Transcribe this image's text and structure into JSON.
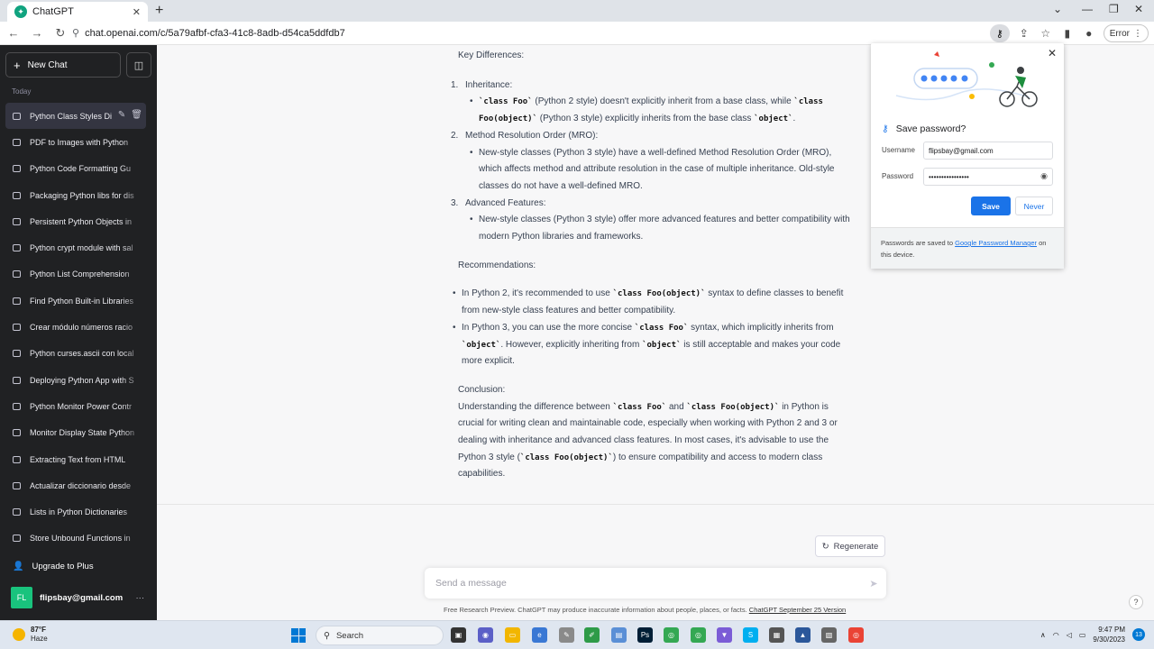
{
  "browser": {
    "tab_title": "ChatGPT",
    "url": "chat.openai.com/c/5a79afbf-cfa3-41c8-8adb-d54ca5ddfdb7",
    "error_label": "Error"
  },
  "sidebar": {
    "new_chat": "New Chat",
    "section_today": "Today",
    "conversations": [
      "Python Class Styles Di",
      "PDF to Images with Python",
      "Python Code Formatting Gu",
      "Packaging Python libs for dis",
      "Persistent Python Objects in",
      "Python crypt module with sal",
      "Python List Comprehension",
      "Find Python Built-in Libraries",
      "Crear módulo números racio",
      "Python curses.ascii con local",
      "Deploying Python App with S",
      "Python Monitor Power Contr",
      "Monitor Display State Python",
      "Extracting Text from HTML",
      "Actualizar diccionario desde",
      "Lists in Python Dictionaries",
      "Store Unbound Functions in"
    ],
    "upgrade": "Upgrade to Plus",
    "avatar_initials": "FL",
    "account_email": "flipsbay@gmail.com"
  },
  "message": {
    "key_diff": "Key Differences:",
    "n1": "1.",
    "inheritance": "Inheritance:",
    "inh_code1": "`class Foo`",
    "inh_t1": " (Python 2 style) doesn't explicitly inherit from a base class, while ",
    "inh_code2": "`class Foo(object)`",
    "inh_t2": " (Python 3 style) explicitly inherits from the base class ",
    "inh_code3": "`object`",
    "inh_t3": ".",
    "n2": "2.",
    "mro": "Method Resolution Order (MRO):",
    "mro_text": "New-style classes (Python 3 style) have a well-defined Method Resolution Order (MRO), which affects method and attribute resolution in the case of multiple inheritance. Old-style classes do not have a well-defined MRO.",
    "n3": "3.",
    "advanced": "Advanced Features:",
    "adv_text": "New-style classes (Python 3 style) offer more advanced features and better compatibility with modern Python libraries and frameworks.",
    "recs": "Recommendations:",
    "rec1_a": "In Python 2, it's recommended to use ",
    "rec1_code": "`class Foo(object)`",
    "rec1_b": " syntax to define classes to benefit from new-style class features and better compatibility.",
    "rec2_a": "In Python 3, you can use the more concise ",
    "rec2_code1": "`class Foo`",
    "rec2_b": " syntax, which implicitly inherits from ",
    "rec2_code2": "`object`",
    "rec2_c": ". However, explicitly inheriting from ",
    "rec2_code3": "`object`",
    "rec2_d": " is still acceptable and makes your code more explicit.",
    "conclusion": "Conclusion:",
    "conc_a": "Understanding the difference between ",
    "conc_code1": "`class Foo`",
    "conc_b": " and ",
    "conc_code2": "`class Foo(object)`",
    "conc_c": " in Python is crucial for writing clean and maintainable code, especially when working with Python 2 and 3 or dealing with inheritance and advanced class features. In most cases, it's advisable to use the Python 3 style (",
    "conc_code3": "`class Foo(object)`",
    "conc_d": ") to ensure compatibility and access to modern class capabilities."
  },
  "regenerate": "Regenerate",
  "composer": {
    "placeholder": "Send a message"
  },
  "footer": {
    "text": "Free Research Preview. ChatGPT may produce inaccurate information about people, places, or facts. ",
    "link": "ChatGPT September 25 Version"
  },
  "help": "?",
  "password_popup": {
    "title": "Save password?",
    "username_label": "Username",
    "username_value": "flipsbay@gmail.com",
    "password_label": "Password",
    "password_value": "••••••••••••••••",
    "save": "Save",
    "never": "Never",
    "foot_a": "Passwords are saved to ",
    "foot_link": "Google Password Manager",
    "foot_b": " on this device."
  },
  "taskbar": {
    "temperature": "87°F",
    "weather": "Haze",
    "search": "Search",
    "time": "9:47 PM",
    "date": "9/30/2023",
    "notifications": "13"
  }
}
